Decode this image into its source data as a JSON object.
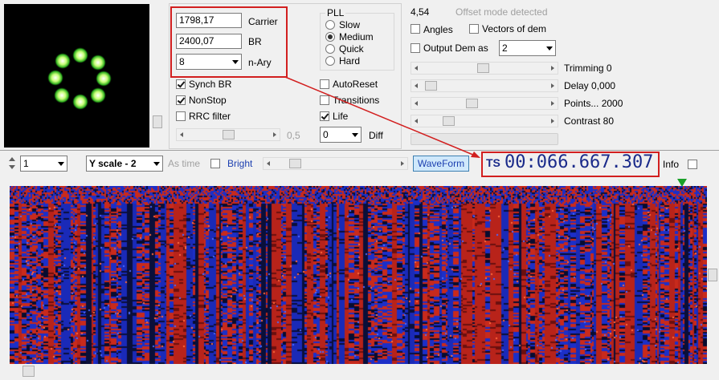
{
  "constellation": {
    "label": "constellation-display"
  },
  "params": {
    "carrier_value": "1798,17",
    "carrier_label": "Carrier",
    "br_value": "2400,07",
    "br_label": "BR",
    "nary_value": "8",
    "nary_label": "n-Ary"
  },
  "pll": {
    "title": "PLL",
    "options": [
      "Slow",
      "Medium",
      "Quick",
      "Hard"
    ],
    "selected": "Medium"
  },
  "checks": {
    "synch_br": "Synch BR",
    "nonstop": "NonStop",
    "rrc_filter": "RRC filter",
    "autoreset": "AutoReset",
    "transitions": "Transitions",
    "life": "Life",
    "rrc_value": "0,5",
    "diff_value": "0",
    "diff_label": "Diff"
  },
  "right": {
    "offset_value": "4,54",
    "offset_status": "Offset mode detected",
    "angles": "Angles",
    "vectors": "Vectors of dem",
    "output_dem": "Output Dem as",
    "output_dem_value": "2",
    "trimming": "Trimming 0",
    "delay": "Delay  0,000",
    "points": "Points... 2000",
    "contrast": "Contrast 80"
  },
  "toolbar": {
    "channel_value": "1",
    "yscale_value": "Y scale - 2",
    "as_time": "As time",
    "bright": "Bright",
    "waveform": "WaveForm",
    "ts_label": "TS",
    "ts_value": "00:066.667.307",
    "info": "Info"
  },
  "colors": {
    "accent_red": "#d21f1f",
    "ts_blue": "#1a2a8a",
    "bright_blue": "#1c3fb0",
    "waveform_bg": "#cfe8fb",
    "plot_bg": "#050830"
  }
}
